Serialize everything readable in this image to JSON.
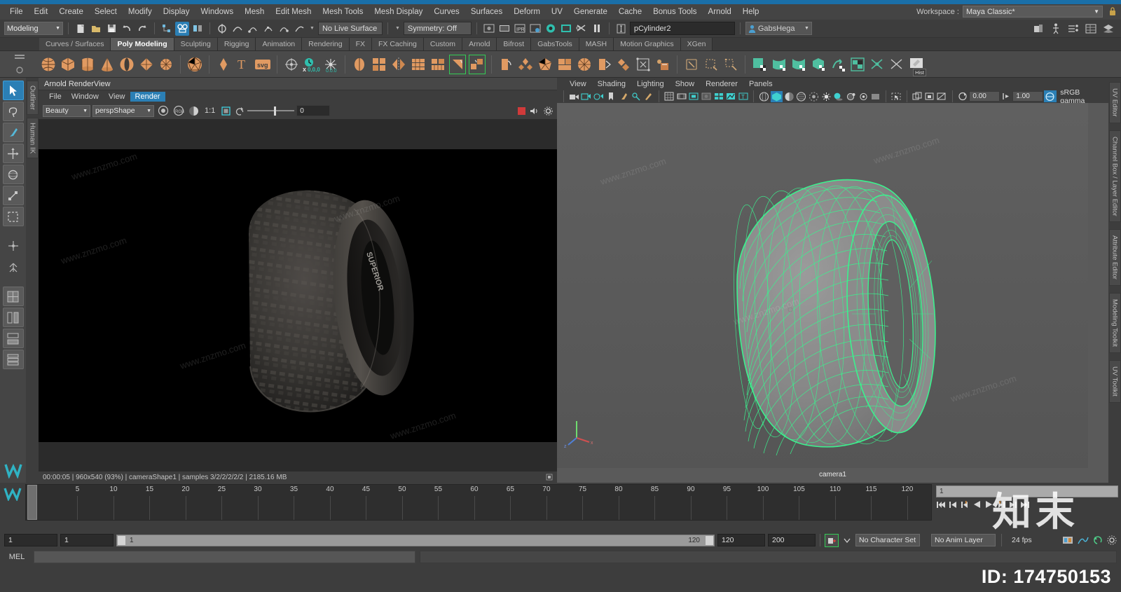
{
  "window": {
    "workspace_label": "Workspace :",
    "workspace_value": "Maya Classic*"
  },
  "menubar": {
    "items": [
      "File",
      "Edit",
      "Create",
      "Select",
      "Modify",
      "Display",
      "Windows",
      "Mesh",
      "Edit Mesh",
      "Mesh Tools",
      "Mesh Display",
      "Curves",
      "Surfaces",
      "Deform",
      "UV",
      "Generate",
      "Cache",
      "Bonus Tools",
      "Arnold",
      "Help"
    ]
  },
  "statusline": {
    "mode": "Modeling",
    "live_surface": "No Live Surface",
    "symmetry": "Symmetry: Off",
    "object_name": "pCylinder2",
    "user": "GabsHega"
  },
  "shelf": {
    "tabs": [
      "Curves / Surfaces",
      "Poly Modeling",
      "Sculpting",
      "Rigging",
      "Animation",
      "Rendering",
      "FX",
      "FX Caching",
      "Custom",
      "Arnold",
      "Bifrost",
      "GabsTools",
      "MASH",
      "Motion Graphics",
      "XGen"
    ],
    "selected_tab": "Poly Modeling",
    "hist_label": "Hist"
  },
  "toolbox": {
    "items": [
      "select-tool",
      "lasso-tool",
      "paint-select-tool",
      "move-tool",
      "rotate-tool",
      "scale-tool",
      "soft-select-tool",
      "last-tool",
      "manipulator-tool",
      "snap-tool",
      "layout-single",
      "layout-two",
      "layout-three",
      "layout-four"
    ]
  },
  "left_rail_tabs": [
    "Outliner",
    "Human IK"
  ],
  "render_view": {
    "title": "Arnold RenderView",
    "menu": [
      "File",
      "Window",
      "View",
      "Render"
    ],
    "menu_selected": "Render",
    "aov": "Beauty",
    "camera": "perspShape",
    "ratio": "1:1",
    "exposure": "0",
    "status": "00:00:05 | 960x540 (93%) | cameraShape1  | samples 3/2/2/2/2/2 | 2185.16 MB"
  },
  "viewport": {
    "menu": [
      "View",
      "Shading",
      "Lighting",
      "Show",
      "Renderer",
      "Panels"
    ],
    "near_value": "0.00",
    "far_value": "1.00",
    "gamma_label": "sRGB gamma",
    "camera_label": "camera1"
  },
  "right_rail_tabs": [
    "UV Editor",
    "Channel Box / Layer Editor",
    "Attribute Editor",
    "Modeling Toolkit",
    "UV Toolkit"
  ],
  "timeline": {
    "tick_labels": [
      "5",
      "10",
      "15",
      "20",
      "25",
      "30",
      "35",
      "40",
      "45",
      "50",
      "55",
      "60",
      "65",
      "70",
      "75",
      "80",
      "85",
      "90",
      "95",
      "100",
      "105",
      "110",
      "115",
      "120"
    ],
    "current_frame": "1",
    "frame_field": "1"
  },
  "range": {
    "start": "1",
    "start2": "1",
    "slider_min": "1",
    "slider_max": "120",
    "anim_end": "120",
    "playback_end": "200",
    "character_set": "No Character Set",
    "anim_layer": "No Anim Layer",
    "fps": "24 fps"
  },
  "command_line": {
    "label": "MEL",
    "input_value": "",
    "output_value": ""
  },
  "watermarks": {
    "site": "www.znzmo.com",
    "brand": "知末",
    "id": "ID: 174750153"
  },
  "colors": {
    "accent_blue": "#2b7fb5",
    "title_blue": "#1a6fa8",
    "wire_green": "#3bf28e",
    "shelf_orange": "#e09a62",
    "shelf_teal": "#4fbfa0",
    "panel_bg": "#3d3d3d",
    "viewport_bg": "#5a5a5a"
  }
}
